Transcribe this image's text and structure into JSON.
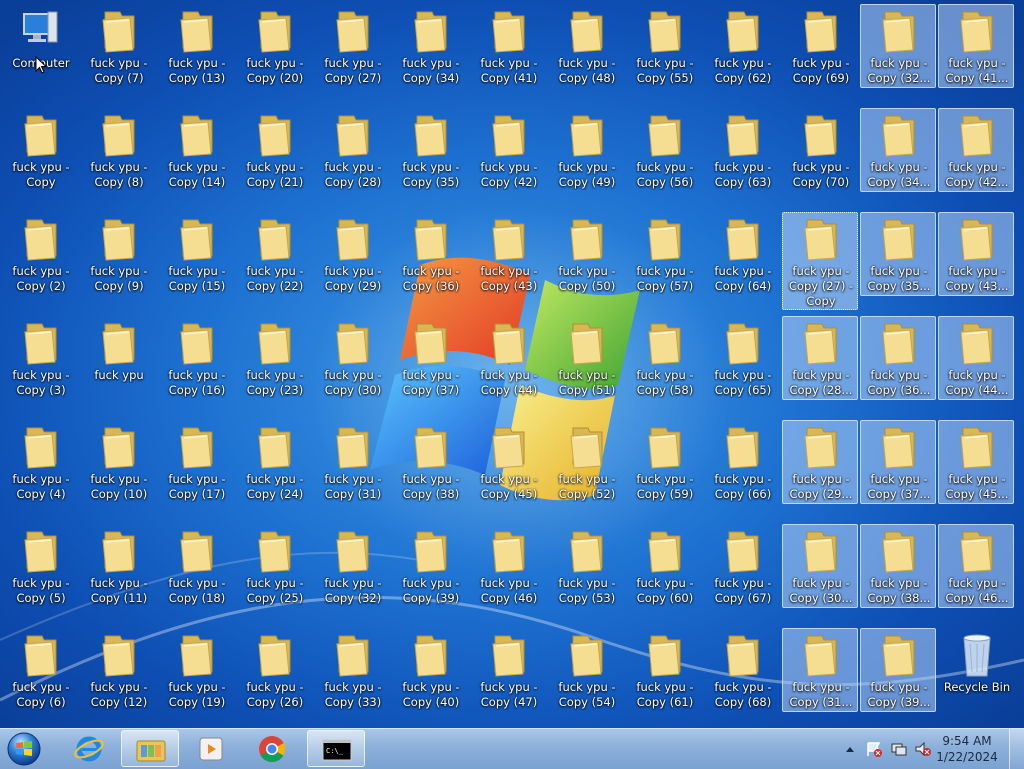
{
  "desktop": {
    "computer": {
      "label": "Computer",
      "icon": "computer-icon"
    },
    "recycle_bin": {
      "label": "Recycle Bin",
      "icon": "recycle-bin-icon"
    },
    "folders": [
      [
        "Copy (7)",
        "Copy (13)",
        "Copy (20)",
        "Copy (27)",
        "Copy (34)",
        "Copy (41)",
        "Copy (48)",
        "Copy (55)",
        "Copy (62)",
        "Copy (69)",
        "Copy (32...",
        "Copy (41..."
      ],
      [
        "Copy",
        "Copy (8)",
        "Copy (14)",
        "Copy (21)",
        "Copy (28)",
        "Copy (35)",
        "Copy (42)",
        "Copy (49)",
        "Copy (56)",
        "Copy (63)",
        "Copy (70)",
        "Copy (34...",
        "Copy (42..."
      ],
      [
        "Copy (2)",
        "Copy (9)",
        "Copy (15)",
        "Copy (22)",
        "Copy (29)",
        "Copy (36)",
        "Copy (43)",
        "Copy (50)",
        "Copy (57)",
        "Copy (64)",
        "Copy (27) - Copy",
        "Copy (35...",
        "Copy (43..."
      ],
      [
        "Copy (3)",
        "",
        "Copy (16)",
        "Copy (23)",
        "Copy (30)",
        "Copy (37)",
        "Copy (44)",
        "Copy (51)",
        "Copy (58)",
        "Copy (65)",
        "Copy (28...",
        "Copy (36...",
        "Copy (44..."
      ],
      [
        "Copy (4)",
        "Copy (10)",
        "Copy (17)",
        "Copy (24)",
        "Copy (31)",
        "Copy (38)",
        "Copy (45)",
        "Copy (52)",
        "Copy (59)",
        "Copy (66)",
        "Copy (29...",
        "Copy (37...",
        "Copy (45..."
      ],
      [
        "Copy (5)",
        "Copy (11)",
        "Copy (18)",
        "Copy (25)",
        "Copy (32)",
        "Copy (39)",
        "Copy (46)",
        "Copy (53)",
        "Copy (60)",
        "Copy (67)",
        "Copy (30...",
        "Copy (38...",
        "Copy (46..."
      ],
      [
        "Copy (6)",
        "Copy (12)",
        "Copy (19)",
        "Copy (26)",
        "Copy (33)",
        "Copy (40)",
        "Copy (47)",
        "Copy (54)",
        "Copy (61)",
        "Copy (68)",
        "Copy (31...",
        "Copy (39..."
      ]
    ],
    "folder_prefix": "fuck ypu -",
    "plain_folder_label": "fuck ypu",
    "selected_note": "folders in right columns are highlighted"
  },
  "taskbar": {
    "start": {
      "icon": "windows-start-orb"
    },
    "pinned": [
      {
        "name": "internet-explorer",
        "icon": "internet-explorer-icon"
      },
      {
        "name": "windows-explorer",
        "icon": "folder-library-icon",
        "active": true
      },
      {
        "name": "media-player",
        "icon": "media-player-icon"
      },
      {
        "name": "chrome",
        "icon": "chrome-icon"
      },
      {
        "name": "command-prompt",
        "icon": "command-prompt-icon",
        "active": true
      }
    ],
    "tray": [
      "show-hidden-icons-arrow",
      "action-center-flag-icon",
      "network-icon",
      "volume-muted-icon"
    ],
    "clock": {
      "time": "9:54 AM",
      "date": "1/22/2024"
    }
  },
  "colors": {
    "taskbar": "#8cb0da",
    "desktop_blue": "#1c6fd0",
    "folder": "#f3d98a"
  }
}
